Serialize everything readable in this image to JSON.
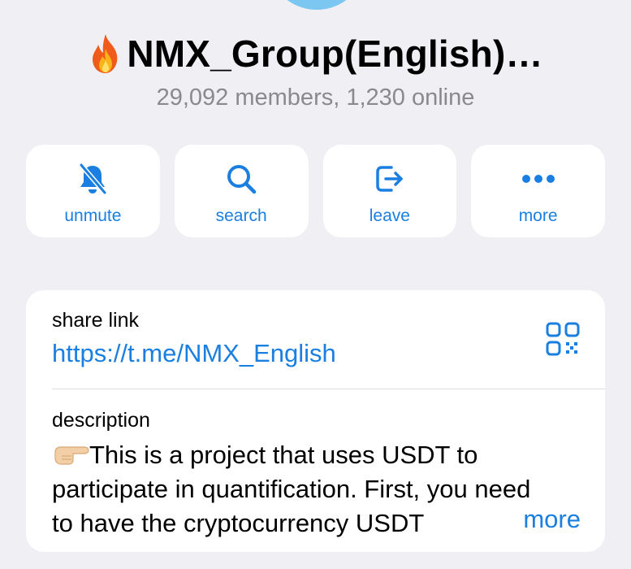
{
  "header": {
    "title": "NMX_Group(English)…",
    "title_icon": "fire-icon",
    "subtitle": "29,092 members, 1,230 online"
  },
  "actions": [
    {
      "label": "unmute",
      "icon": "bell-slash-icon"
    },
    {
      "label": "search",
      "icon": "search-icon"
    },
    {
      "label": "leave",
      "icon": "leave-icon"
    },
    {
      "label": "more",
      "icon": "ellipsis-icon"
    }
  ],
  "info": {
    "share_caption": "share link",
    "share_url": "https://t.me/NMX_English",
    "qr_icon": "qr-code-icon",
    "description_caption": "description",
    "description_text": "This is a project that uses USDT to participate in quantification. First, you need to have the cryptocurrency USDT",
    "description_emoji": "pointing-right-icon",
    "more_label": "more"
  },
  "colors": {
    "accent": "#1a7fe0",
    "background": "#efeff4",
    "secondary_text": "#8a8a8e"
  }
}
